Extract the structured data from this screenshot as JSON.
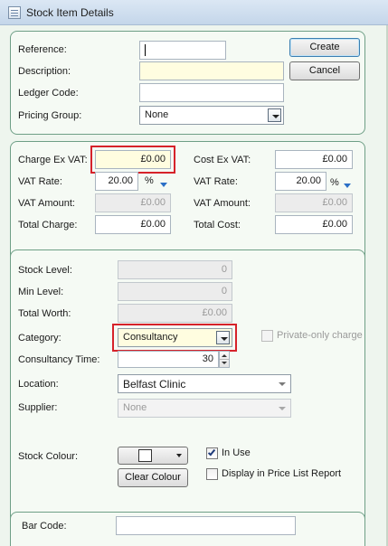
{
  "window": {
    "title": "Stock Item Details"
  },
  "details": {
    "reference_label": "Reference:",
    "reference_value": "",
    "description_label": "Description:",
    "description_value": "",
    "ledger_code_label": "Ledger Code:",
    "ledger_code_value": "",
    "pricing_group_label": "Pricing Group:",
    "pricing_group_value": "None",
    "create_label": "Create",
    "cancel_label": "Cancel"
  },
  "pricing": {
    "charge_ex_vat_label": "Charge Ex VAT:",
    "charge_ex_vat_value": "£0.00",
    "cost_ex_vat_label": "Cost Ex VAT:",
    "cost_ex_vat_value": "£0.00",
    "vat_rate_label": "VAT Rate:",
    "vat_rate_value": "20.00",
    "cost_vat_rate_label": "VAT Rate:",
    "cost_vat_rate_value": "20.00",
    "percent_symbol": "%",
    "vat_amount_label": "VAT Amount:",
    "vat_amount_value": "£0.00",
    "cost_vat_amount_label": "VAT Amount:",
    "cost_vat_amount_value": "£0.00",
    "total_charge_label": "Total Charge:",
    "total_charge_value": "£0.00",
    "total_cost_label": "Total Cost:",
    "total_cost_value": "£0.00"
  },
  "stock": {
    "stock_level_label": "Stock Level:",
    "stock_level_value": "0",
    "min_level_label": "Min Level:",
    "min_level_value": "0",
    "total_worth_label": "Total Worth:",
    "total_worth_value": "£0.00",
    "category_label": "Category:",
    "category_value": "Consultancy",
    "private_only_label": "Private-only charge",
    "consultancy_time_label": "Consultancy Time:",
    "consultancy_time_value": "30",
    "location_label": "Location:",
    "location_value": "Belfast Clinic",
    "supplier_label": "Supplier:",
    "supplier_value": "None",
    "stock_colour_label": "Stock Colour:",
    "clear_colour_label": "Clear Colour",
    "in_use_label": "In Use",
    "in_use_checked": true,
    "display_price_list_label": "Display in Price List Report",
    "display_price_list_checked": false
  },
  "barcode": {
    "bar_code_label": "Bar Code:",
    "bar_code_value": ""
  },
  "colors": {
    "highlight": "#d6222a",
    "panel_border": "#6e9f86",
    "panel_bg": "#f5faf4",
    "vat_arrow": "#2b6fc6"
  }
}
